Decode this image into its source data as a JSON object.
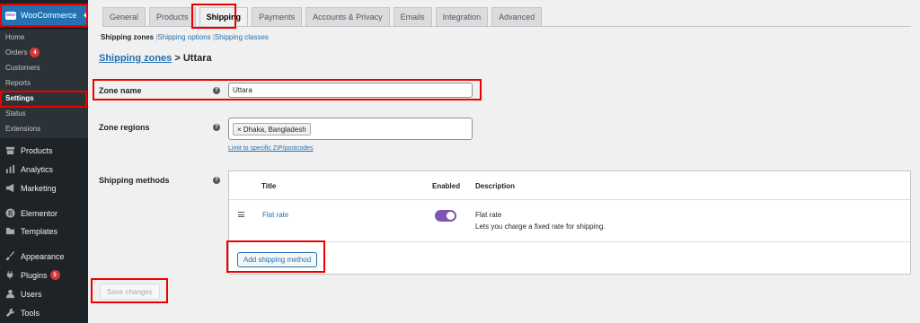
{
  "sidebar": {
    "woocommerce_label": "WooCommerce",
    "logo_text": "woo",
    "submenu": [
      {
        "label": "Home"
      },
      {
        "label": "Orders",
        "badge": "4"
      },
      {
        "label": "Customers"
      },
      {
        "label": "Reports"
      },
      {
        "label": "Settings"
      },
      {
        "label": "Status"
      },
      {
        "label": "Extensions"
      }
    ],
    "menu": [
      {
        "label": "Products",
        "icon": "archive-icon"
      },
      {
        "label": "Analytics",
        "icon": "bar-chart-icon"
      },
      {
        "label": "Marketing",
        "icon": "megaphone-icon"
      },
      {
        "label": "Elementor",
        "icon": "elementor-icon"
      },
      {
        "label": "Templates",
        "icon": "folder-icon"
      },
      {
        "label": "Appearance",
        "icon": "paintbrush-icon"
      },
      {
        "label": "Plugins",
        "icon": "plug-icon",
        "badge": "5"
      },
      {
        "label": "Users",
        "icon": "user-icon"
      },
      {
        "label": "Tools",
        "icon": "wrench-icon"
      }
    ]
  },
  "tabs": [
    "General",
    "Products",
    "Shipping",
    "Payments",
    "Accounts & Privacy",
    "Emails",
    "Integration",
    "Advanced"
  ],
  "subnav": {
    "zones": "Shipping zones",
    "options": "Shipping options",
    "classes": "Shipping classes",
    "sep": "|"
  },
  "breadcrumb": {
    "link": "Shipping zones",
    "separator": ">",
    "current": "Uttara"
  },
  "zone_name": {
    "label": "Zone name",
    "value": "Uttara"
  },
  "zone_regions": {
    "label": "Zone regions",
    "chip": "× Dhaka, Bangladesh",
    "limit_link": "Limit to specific ZIP/postcodes"
  },
  "shipping_methods": {
    "label": "Shipping methods",
    "headers": {
      "title": "Title",
      "enabled": "Enabled",
      "description": "Description"
    },
    "rows": [
      {
        "title": "Flat rate",
        "enabled": true,
        "desc_title": "Flat rate",
        "desc_text": "Lets you charge a fixed rate for shipping."
      }
    ],
    "add_button": "Add shipping method"
  },
  "help_glyph": "?",
  "save_button": "Save changes",
  "colors": {
    "accent": "#2271b1",
    "toggle": "#7f54b3",
    "highlight": "#e00000",
    "badge": "#d63638"
  }
}
